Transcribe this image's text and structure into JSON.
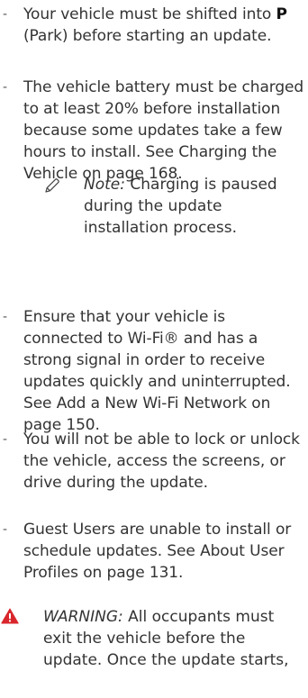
{
  "items": [
    {
      "pre": "Your vehicle must be shifted into ",
      "bold": "P",
      "post": " (Park) before starting an update."
    },
    {
      "text": "The vehicle battery must be charged to at least 20% before installation because some updates take a few hours to install. See Charging the Vehicle on page 168."
    },
    {
      "text": "Ensure that your vehicle is connected to Wi-Fi® and has a strong signal in order to receive updates quickly and uninterrupted. See Add a New Wi-Fi Network on page 150."
    },
    {
      "text": "You will not be able to lock or unlock the vehicle, access the screens, or drive during the update."
    },
    {
      "text": "Guest Users are unable to install or schedule updates. See About User Profiles on page 131."
    }
  ],
  "dash": "-",
  "note": {
    "label": "Note:",
    "text": " Charging is paused during the update installation process."
  },
  "warning": {
    "label": "WARNING:",
    "text": " All occupants must exit the vehicle before the update. Once the update starts,"
  },
  "colors": {
    "text": "#333333",
    "warning_icon": "#d9262c"
  },
  "icons": {
    "note": "pencil-icon",
    "warning": "warning-triangle-icon"
  }
}
